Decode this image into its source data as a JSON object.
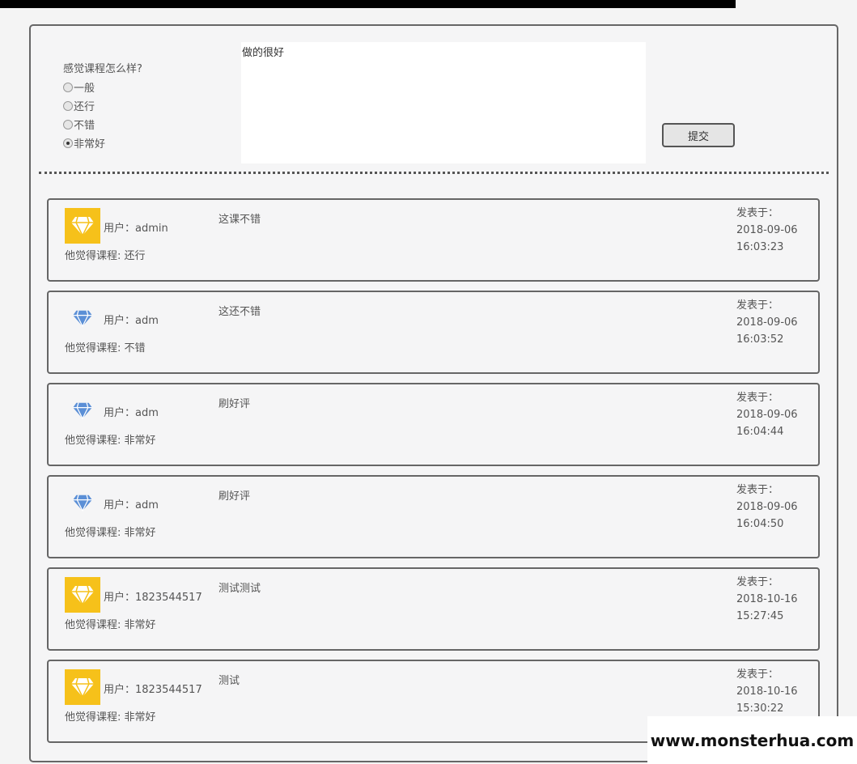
{
  "form": {
    "question": "感觉课程怎么样?",
    "options": [
      {
        "label": "一般",
        "checked": false
      },
      {
        "label": "还行",
        "checked": false
      },
      {
        "label": "不错",
        "checked": false
      },
      {
        "label": "非常好",
        "checked": true
      }
    ],
    "comment_value": "做的很好",
    "submit_label": "提交"
  },
  "comments": [
    {
      "avatar": "gold-diamond-icon",
      "user": "用户：admin",
      "opinion": "他觉得课程: 还行",
      "content": "这课不错",
      "posted_label": "发表于：",
      "date": "2018-09-06",
      "time": "16:03:23"
    },
    {
      "avatar": "blue-diamond-icon",
      "user": "用户：adm",
      "opinion": "他觉得课程: 不错",
      "content": "这还不错",
      "posted_label": "发表于：",
      "date": "2018-09-06",
      "time": "16:03:52"
    },
    {
      "avatar": "blue-diamond-icon",
      "user": "用户：adm",
      "opinion": "他觉得课程: 非常好",
      "content": "刷好评",
      "posted_label": "发表于：",
      "date": "2018-09-06",
      "time": "16:04:44"
    },
    {
      "avatar": "blue-diamond-icon",
      "user": "用户：adm",
      "opinion": "他觉得课程: 非常好",
      "content": "刷好评",
      "posted_label": "发表于：",
      "date": "2018-09-06",
      "time": "16:04:50"
    },
    {
      "avatar": "gold-diamond-icon",
      "user": "用户：1823544517",
      "opinion": "他觉得课程: 非常好",
      "content": "测试测试",
      "posted_label": "发表于：",
      "date": "2018-10-16",
      "time": "15:27:45"
    },
    {
      "avatar": "gold-diamond-icon",
      "user": "用户：1823544517",
      "opinion": "他觉得课程: 非常好",
      "content": "测试",
      "posted_label": "发表于：",
      "date": "2018-10-16",
      "time": "15:30:22"
    }
  ],
  "watermark": "www.monsterhua.com",
  "colors": {
    "gold": "#f6c11a",
    "blue": "#5b8fd6"
  }
}
